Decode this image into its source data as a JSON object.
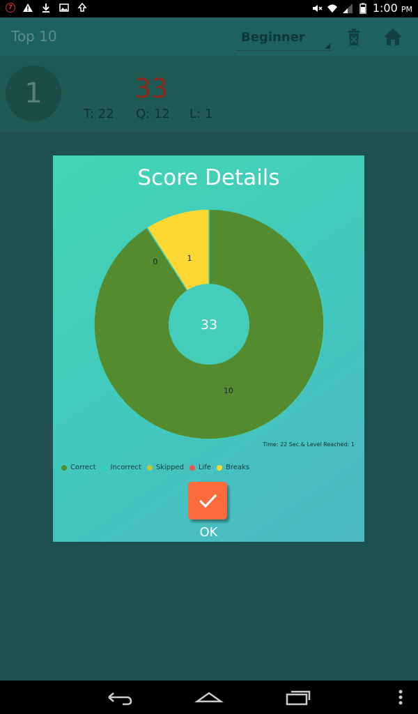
{
  "statusbar": {
    "badge": "7",
    "time": "1:00",
    "ampm": "PM"
  },
  "appbar": {
    "title": "Top 10",
    "level_selected": "Beginner"
  },
  "score": {
    "rank": "1",
    "value": "33",
    "time_stat": "T: 22",
    "questions_stat": "Q: 12",
    "lives_stat": "L: 1"
  },
  "dialog": {
    "title": "Score Details",
    "footnote": "Time: 22 Sec.& Level Reached: 1",
    "ok_label": "OK"
  },
  "chart_data": {
    "type": "pie",
    "center_label": "33",
    "slices": [
      {
        "name": "Correct",
        "value": 10,
        "color": "#558b2f",
        "label": "10"
      },
      {
        "name": "Incorrect",
        "value": 0,
        "color": "#2ad1c0",
        "label": "0"
      },
      {
        "name": "Skipped",
        "value": 1,
        "color": "#fdd835",
        "label": "1"
      },
      {
        "name": "Life",
        "value": 0,
        "color": "#ef5350",
        "label": ""
      },
      {
        "name": "Breaks",
        "value": 0,
        "color": "#fdd835",
        "label": ""
      }
    ],
    "legend": [
      "Correct",
      "Incorrect",
      "Skipped",
      "Life",
      "Breaks"
    ],
    "legend_colors": [
      "#558b2f",
      "#2ad1c0",
      "#c0ca33",
      "#ef5350",
      "#fdd835"
    ],
    "legend_position": "bottom-left"
  }
}
